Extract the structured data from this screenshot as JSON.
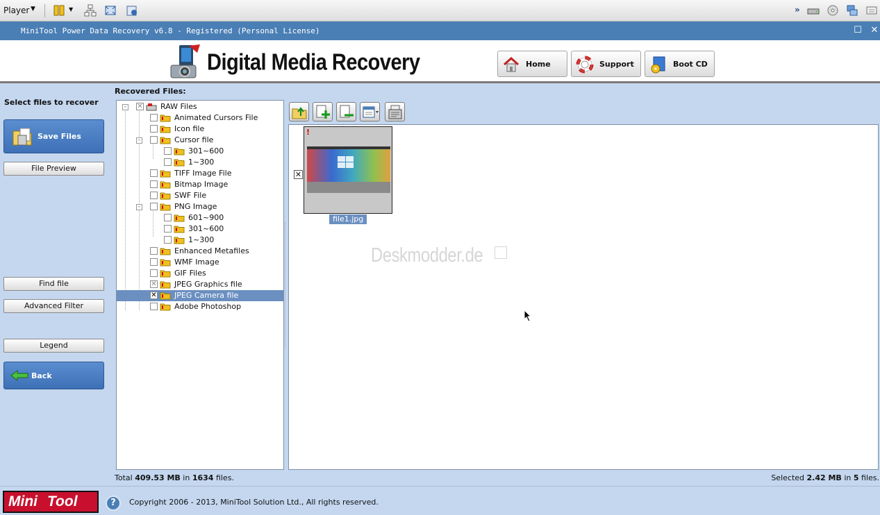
{
  "player": {
    "label": "Player"
  },
  "window": {
    "title": "MiniTool Power Data Recovery v6.8 - Registered (Personal License)"
  },
  "header": {
    "brand": "Digital Media Recovery",
    "buttons": [
      {
        "label": "Home",
        "icon": "home-icon"
      },
      {
        "label": "Support",
        "icon": "lifebuoy-icon"
      },
      {
        "label": "Boot CD",
        "icon": "boot-cd-icon"
      }
    ]
  },
  "sidebar": {
    "title": "Select files to recover",
    "save_files": "Save Files",
    "file_preview": "File Preview",
    "find_file": "Find file",
    "advanced_filter": "Advanced Filter",
    "legend": "Legend",
    "back": "Back"
  },
  "main": {
    "title": "Recovered Files:",
    "tree": [
      {
        "label": "RAW Files",
        "level": 0,
        "check": "partial",
        "expander": "-"
      },
      {
        "label": "Animated Cursors File",
        "level": 1,
        "check": "none"
      },
      {
        "label": "Icon file",
        "level": 1,
        "check": "none"
      },
      {
        "label": "Cursor file",
        "level": 1,
        "check": "none",
        "expander": "-"
      },
      {
        "label": "301~600",
        "level": 2,
        "check": "none"
      },
      {
        "label": "1~300",
        "level": 2,
        "check": "none"
      },
      {
        "label": "TIFF Image File",
        "level": 1,
        "check": "none"
      },
      {
        "label": "Bitmap Image",
        "level": 1,
        "check": "none"
      },
      {
        "label": "SWF File",
        "level": 1,
        "check": "none"
      },
      {
        "label": "PNG Image",
        "level": 1,
        "check": "none",
        "expander": "-"
      },
      {
        "label": "601~900",
        "level": 2,
        "check": "none"
      },
      {
        "label": "301~600",
        "level": 2,
        "check": "none"
      },
      {
        "label": "1~300",
        "level": 2,
        "check": "none"
      },
      {
        "label": "Enhanced Metafiles",
        "level": 1,
        "check": "none"
      },
      {
        "label": "WMF Image",
        "level": 1,
        "check": "none"
      },
      {
        "label": "GIF Files",
        "level": 1,
        "check": "none"
      },
      {
        "label": "JPEG Graphics file",
        "level": 1,
        "check": "partial"
      },
      {
        "label": "JPEG Camera file",
        "level": 1,
        "check": "checked",
        "selected": true
      },
      {
        "label": "Adobe Photoshop",
        "level": 1,
        "check": "none"
      }
    ],
    "toolbar_icons": [
      "folder-up-icon",
      "add-file-icon",
      "remove-file-icon",
      "view-mode-icon",
      "file-properties-icon"
    ],
    "file": {
      "name": "file1.jpg",
      "mark": "!"
    },
    "watermark": "Deskmodder.de"
  },
  "status": {
    "total_prefix": "Total ",
    "total_size": "409.53 MB",
    "total_mid": " in ",
    "total_count": "1634",
    "total_suffix": " files.",
    "sel_prefix": "Selected ",
    "sel_size": "2.42 MB",
    "sel_mid": " in ",
    "sel_count": "5",
    "sel_suffix": " files."
  },
  "footer": {
    "logo_left": "Mini",
    "logo_right": "Tool",
    "help": "?",
    "copyright": "Copyright 2006 - 2013, MiniTool Solution Ltd., All rights reserved."
  },
  "colors": {
    "titlebar": "#4a7fb5",
    "panel": "#c4d7ef",
    "selection": "#6b8fc0",
    "brand_red": "#c8102e"
  }
}
